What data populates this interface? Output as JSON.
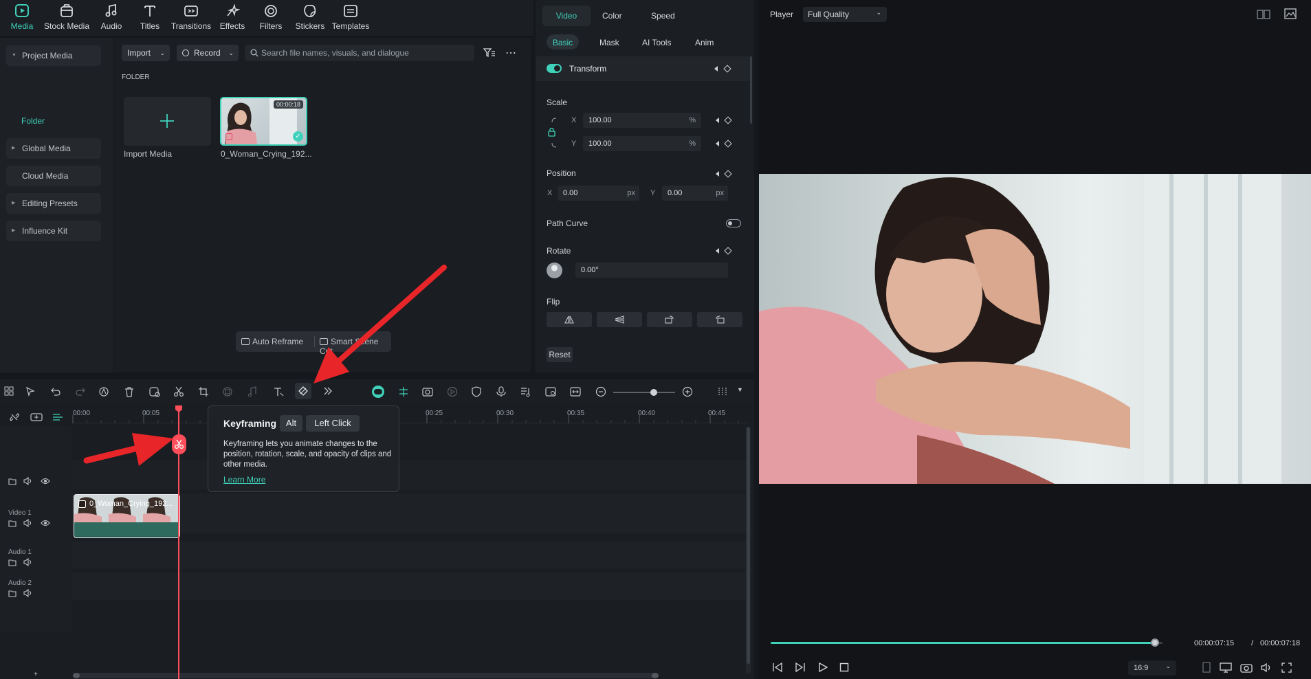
{
  "toolbar": {
    "items": [
      {
        "label": "Media",
        "icon": "media-icon",
        "active": true
      },
      {
        "label": "Stock Media",
        "icon": "stock-media-icon"
      },
      {
        "label": "Audio",
        "icon": "audio-icon"
      },
      {
        "label": "Titles",
        "icon": "titles-icon"
      },
      {
        "label": "Transitions",
        "icon": "transitions-icon"
      },
      {
        "label": "Effects",
        "icon": "effects-icon"
      },
      {
        "label": "Filters",
        "icon": "filters-icon"
      },
      {
        "label": "Stickers",
        "icon": "stickers-icon"
      },
      {
        "label": "Templates",
        "icon": "templates-icon"
      }
    ]
  },
  "left_nav": {
    "items": [
      "Project Media",
      "Global Media",
      "Cloud Media",
      "Editing Presets",
      "Influence Kit"
    ],
    "folder": "Folder"
  },
  "media": {
    "import_label": "Import",
    "record_label": "Record",
    "search_placeholder": "Search file names, visuals, and dialogue",
    "folder_heading": "FOLDER",
    "import_media_label": "Import Media",
    "clip_name": "0_Woman_Crying_192...",
    "clip_duration": "00:00:18",
    "auto_reframe": "Auto Reframe",
    "smart_scene_cut": "Smart Scene Cut"
  },
  "props": {
    "tabs": [
      "Video",
      "Color",
      "Speed"
    ],
    "subtabs": [
      "Basic",
      "Mask",
      "AI Tools",
      "Anim"
    ],
    "transform": "Transform",
    "scale": "Scale",
    "scale_x": "100.00",
    "scale_y": "100.00",
    "pct": "%",
    "x": "X",
    "y": "Y",
    "position": "Position",
    "pos_x": "0.00",
    "pos_y": "0.00",
    "px": "px",
    "path_curve": "Path Curve",
    "rotate": "Rotate",
    "rotate_val": "0.00°",
    "flip": "Flip",
    "reset": "Reset"
  },
  "player": {
    "label": "Player",
    "quality": "Full Quality",
    "current_time": "00:00:07:15",
    "separator": "/",
    "total_time": "00:00:07:18",
    "aspect": "16:9",
    "progress": 0.98
  },
  "timeline": {
    "ruler": [
      "00:00",
      "00:05",
      "00:25",
      "00:30",
      "00:35",
      "00:40",
      "00:45"
    ],
    "tracks": [
      "Video 1",
      "Audio 1",
      "Audio 2"
    ],
    "clip_name": "0_Woman_Crying_192...",
    "zoom_level": 0.65
  },
  "tooltip": {
    "title": "Keyframing",
    "key1": "Alt",
    "key2": "Left Click",
    "body": "Keyframing lets you animate changes to the position, rotation, scale, and opacity of clips and other media.",
    "link": "Learn More"
  },
  "colors": {
    "accent": "#3fd1b9",
    "arrow": "#e8262a",
    "playhead": "#ff4d5a"
  }
}
